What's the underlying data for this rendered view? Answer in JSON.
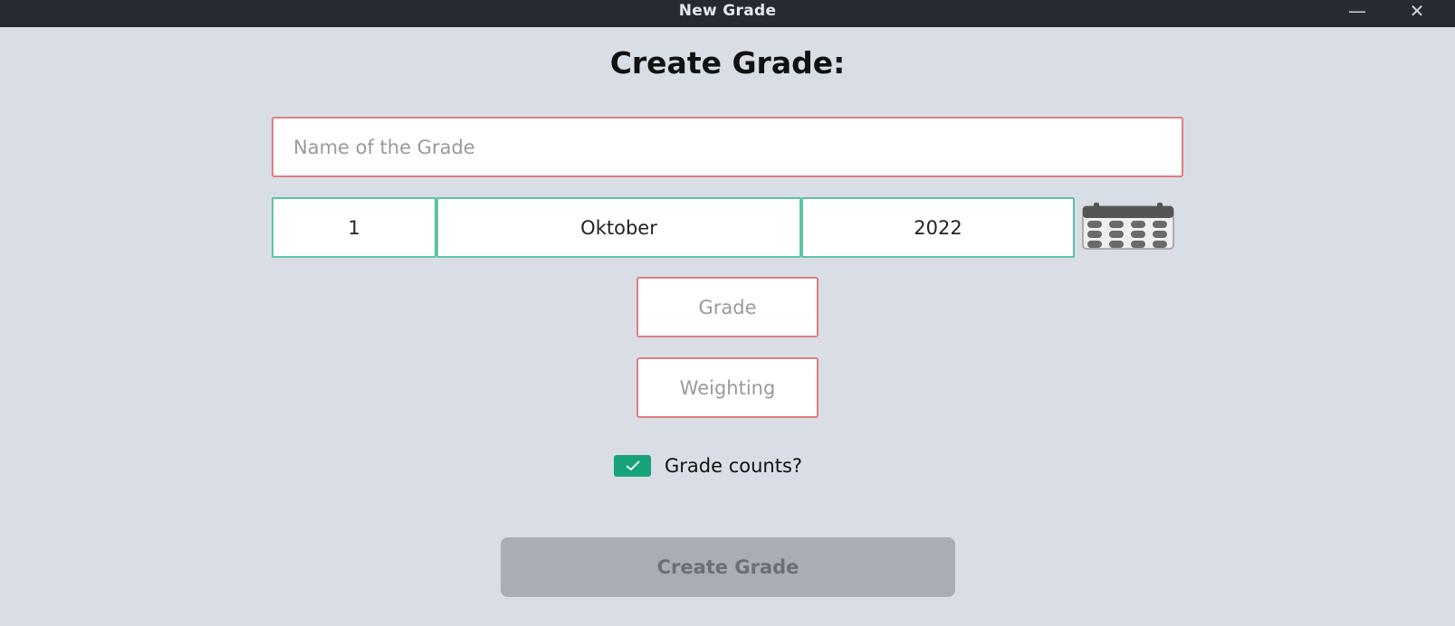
{
  "window": {
    "title": "New Grade",
    "minimize_icon": "minimize-icon",
    "close_icon": "close-icon"
  },
  "form": {
    "heading": "Create Grade:",
    "name_placeholder": "Name of the Grade",
    "date": {
      "day": "1",
      "month": "Oktober",
      "year": "2022",
      "picker_icon": "calendar-icon"
    },
    "grade_placeholder": "Grade",
    "weighting_placeholder": "Weighting",
    "counts": {
      "label": "Grade counts?",
      "checked": true
    },
    "submit_label": "Create Grade"
  },
  "colors": {
    "background": "#d9dde5",
    "titlebar": "#262a33",
    "required_border": "#e07c82",
    "valid_border": "#5cc3a3",
    "checkbox": "#17a37a",
    "button_disabled": "#a9aeb6"
  }
}
